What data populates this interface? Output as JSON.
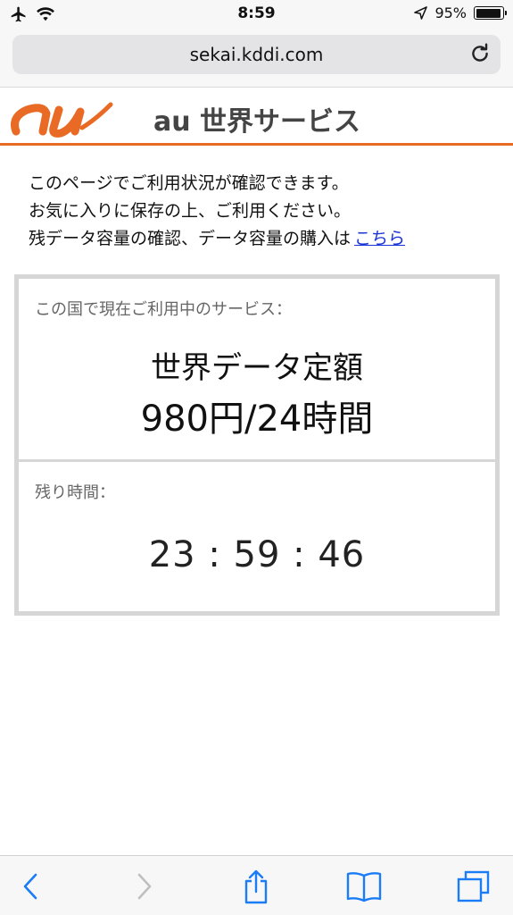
{
  "status_bar": {
    "time": "8:59",
    "battery_percent": "95%",
    "battery_level": 0.95,
    "icons": [
      "airplane-icon",
      "wifi-icon",
      "location-icon",
      "battery-icon"
    ]
  },
  "browser": {
    "url": "sekai.kddi.com",
    "icons": [
      "reload-icon",
      "back-icon",
      "forward-icon",
      "share-icon",
      "bookmarks-icon",
      "tabs-icon"
    ]
  },
  "header": {
    "logo_text": "au",
    "title": "au 世界サービス",
    "accent_color": "#e96a24"
  },
  "intro": {
    "line1": "このページでご利用状況が確認できます。",
    "line2": "お気に入りに保存の上、ご利用ください。",
    "line3": "残データ容量の確認、データ容量の購入は",
    "link": "こちら",
    "link_color": "#1a33d6"
  },
  "service": {
    "label": "この国で現在ご利用中のサービス：",
    "plan_name": "世界データ定額",
    "plan_price": "980円/24時間"
  },
  "remaining": {
    "label": "残り時間：",
    "time": "23 : 59 : 46"
  }
}
